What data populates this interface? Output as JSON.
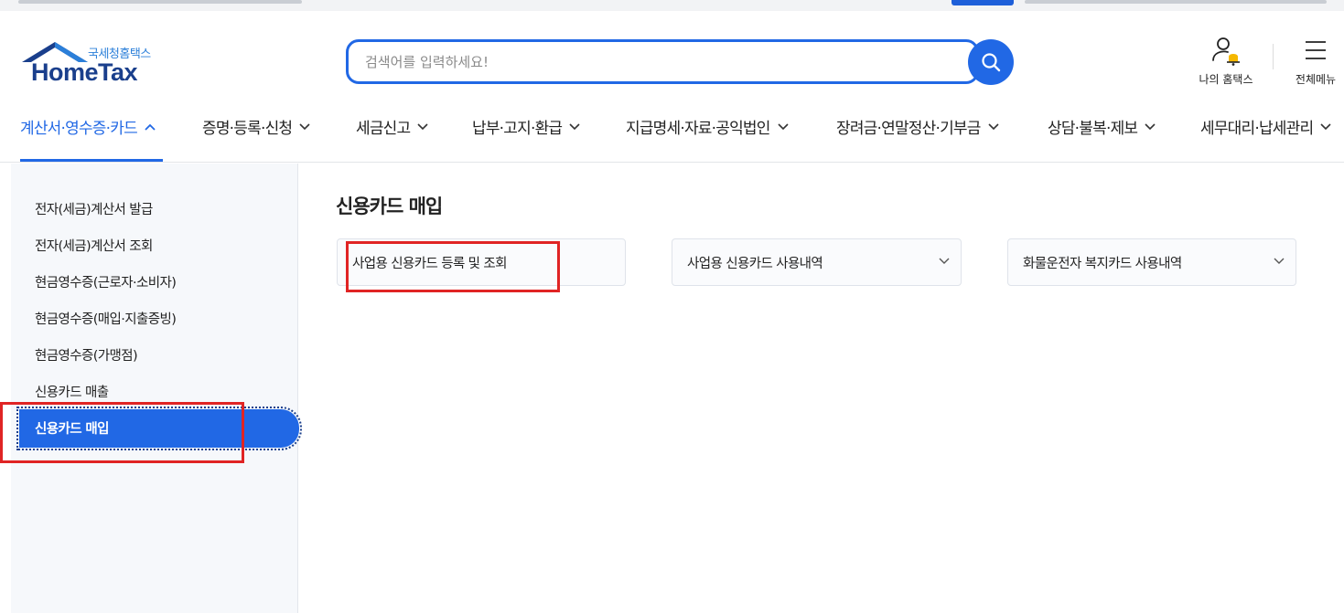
{
  "header": {
    "logo_sub": "국세청홈택스",
    "logo_main": "HomeTax",
    "search_placeholder": "검색어를 입력하세요!",
    "my_hometax_label": "나의 홈택스",
    "all_menu_label": "전체메뉴"
  },
  "gnb": {
    "items": [
      {
        "label": "계산서·영수증·카드",
        "active": true
      },
      {
        "label": "증명·등록·신청",
        "active": false
      },
      {
        "label": "세금신고",
        "active": false
      },
      {
        "label": "납부·고지·환급",
        "active": false
      },
      {
        "label": "지급명세·자료·공익법인",
        "active": false
      },
      {
        "label": "장려금·연말정산·기부금",
        "active": false
      },
      {
        "label": "상담·불복·제보",
        "active": false
      },
      {
        "label": "세무대리·납세관리",
        "active": false
      }
    ]
  },
  "lnb": {
    "items": [
      {
        "label": "전자(세금)계산서 발급"
      },
      {
        "label": "전자(세금)계산서 조회"
      },
      {
        "label": "현금영수증(근로자·소비자)"
      },
      {
        "label": "현금영수증(매입·지출증빙)"
      },
      {
        "label": "현금영수증(가맹점)"
      },
      {
        "label": "신용카드 매출"
      },
      {
        "label": "신용카드 매입"
      }
    ],
    "active_index": 6
  },
  "main": {
    "title": "신용카드 매입",
    "cards": [
      {
        "label": "사업용 신용카드 등록 및 조회",
        "has_chevron": false
      },
      {
        "label": "사업용 신용카드 사용내역",
        "has_chevron": true
      },
      {
        "label": "화물운전자 복지카드 사용내역",
        "has_chevron": true
      }
    ]
  },
  "colors": {
    "primary": "#2168e5",
    "logo_navy": "#1a3f8c",
    "highlight": "#e02424",
    "sidebar_bg": "#f6f8fb"
  }
}
